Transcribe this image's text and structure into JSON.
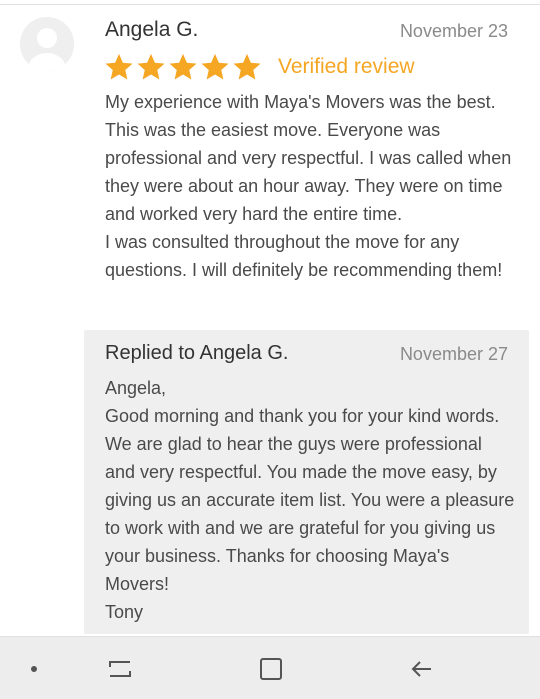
{
  "review": {
    "reviewer_name": "Angela G.",
    "date": "November 23",
    "rating": 5,
    "max_rating": 5,
    "verified_label": "Verified review",
    "text": "My experience with Maya's Movers was the best. This was the easiest move. Everyone was professional and very respectful. I was called when they were about an hour away. They were on time and worked very hard the entire time.\nI was consulted throughout the move for any questions. I will definitely be recommending them!"
  },
  "reply": {
    "title": "Replied to Angela G.",
    "date": "November 27",
    "text": "Angela,\nGood morning and thank you for your kind words. We are glad to hear the guys were professional and very respectful. You made the move easy, by giving us an accurate item list. You were a pleasure to work with and we are grateful for you giving us your business. Thanks for choosing Maya's Movers!\nTony"
  },
  "colors": {
    "star": "#f5a623",
    "verified": "#f5a623",
    "reply_background": "#eeefee",
    "nav_background": "#ededed"
  },
  "nav": {
    "items": [
      "dot-icon",
      "recent-apps-icon",
      "home-icon",
      "back-icon"
    ]
  }
}
